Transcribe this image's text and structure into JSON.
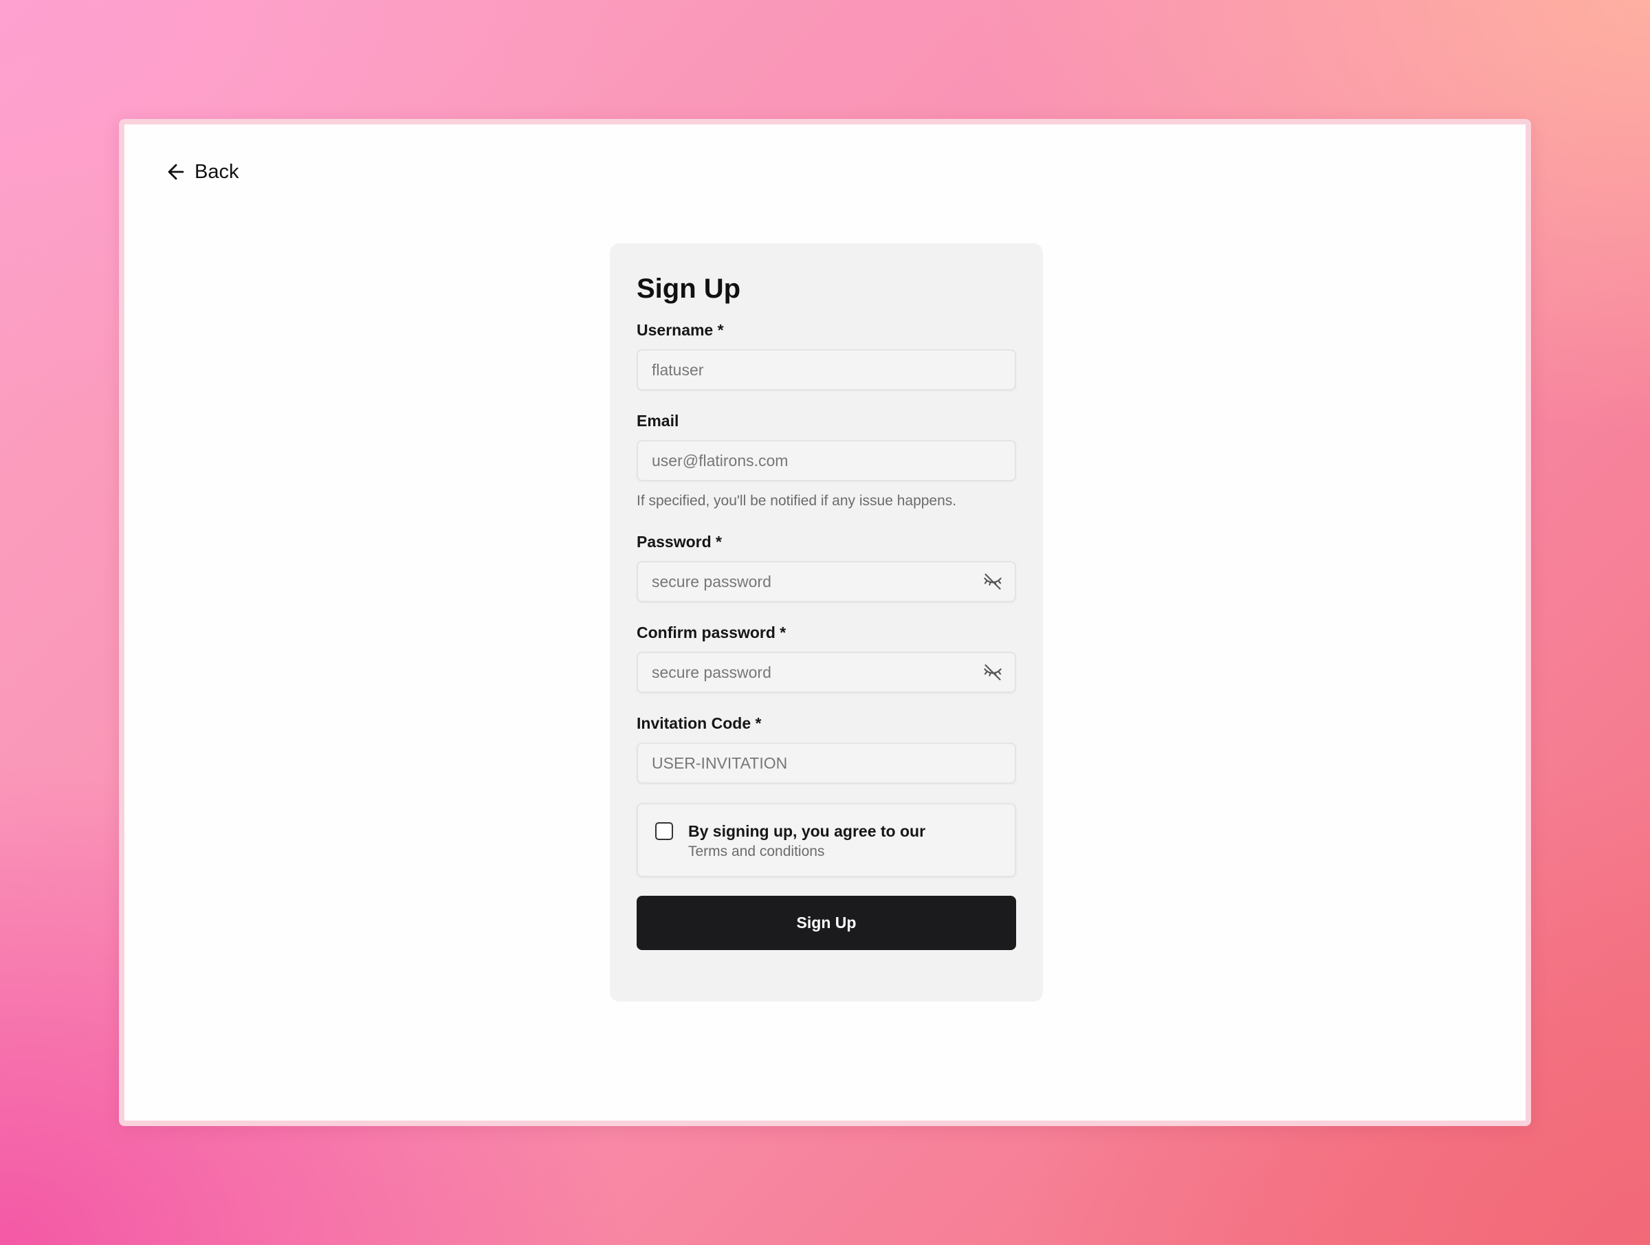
{
  "nav": {
    "back_label": "Back"
  },
  "form": {
    "title": "Sign Up",
    "username": {
      "label": "Username *",
      "placeholder": "flatuser"
    },
    "email": {
      "label": "Email",
      "placeholder": "user@flatirons.com",
      "hint": "If specified, you'll be notified if any issue happens."
    },
    "password": {
      "label": "Password *",
      "placeholder": "secure password",
      "visibility_icon": "eye-off-icon"
    },
    "confirm_password": {
      "label": "Confirm password *",
      "placeholder": "secure password",
      "visibility_icon": "eye-off-icon"
    },
    "invitation_code": {
      "label": "Invitation Code *",
      "placeholder": "USER-INVITATION"
    },
    "terms": {
      "checked": false,
      "label": "By signing up, you agree to our",
      "link_text": "Terms and conditions"
    },
    "submit_label": "Sign Up"
  },
  "colors": {
    "button_bg": "#1b1b1d",
    "card_bg": "#f2f2f2",
    "window_border": "#f9d2dc"
  }
}
